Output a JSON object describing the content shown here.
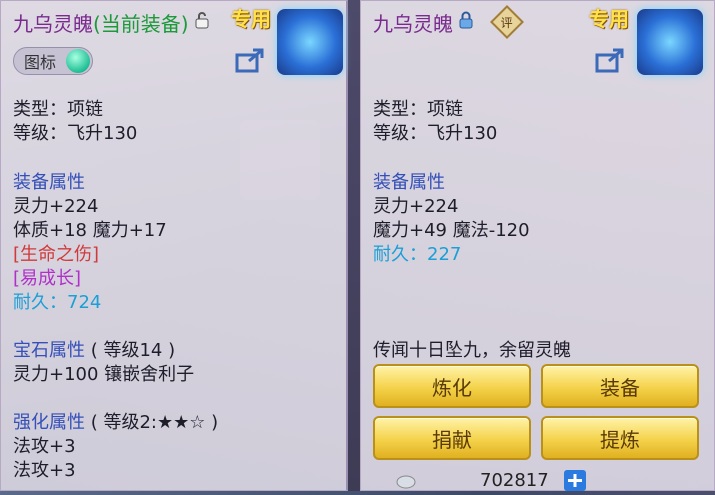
{
  "left": {
    "name": "九乌灵魄",
    "equipped_tag": "(当前装备)",
    "exclusive_label": "专用",
    "toggle_label": "图标",
    "type_line": "类型：项链",
    "level_line": "等级：飞升130",
    "attr_title": "装备属性",
    "attrs": [
      "灵力+224",
      "体质+18 魔力+17"
    ],
    "special1": "[生命之伤]",
    "special2": "[易成长]",
    "durability": "耐久：724",
    "gem_title": "宝石属性",
    "gem_level": "( 等级14 )",
    "gem_line": "灵力+100 镶嵌舍利子",
    "enhance_title": "强化属性",
    "enhance_level": "( 等级2:★★☆ )",
    "enhance_lines": [
      "法攻+3",
      "法攻+3"
    ]
  },
  "right": {
    "name": "九乌灵魄",
    "badge": "评",
    "exclusive_label": "专用",
    "type_line": "类型：项链",
    "level_line": "等级：飞升130",
    "attr_title": "装备属性",
    "attrs": [
      "灵力+224",
      "魔力+49 魔法-120"
    ],
    "durability": "耐久：227",
    "description": "传闻十日坠九，余留灵魄",
    "buttons": [
      "炼化",
      "装备",
      "捐献",
      "提炼"
    ],
    "currency": "702817"
  },
  "colors": {
    "name": "#7a2a8e",
    "equipped": "#1c9a3a",
    "section": "#3550b8",
    "durability": "#1a9fd6",
    "button": "#f4d24a"
  }
}
